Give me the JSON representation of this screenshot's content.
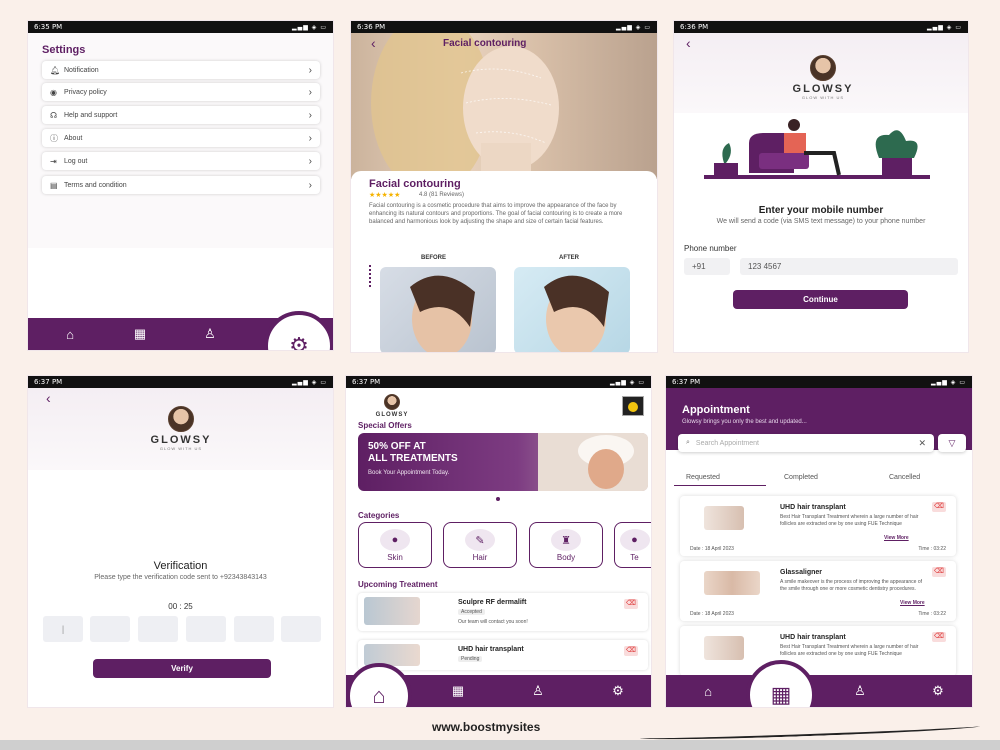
{
  "s1": {
    "status_time": "6:35 PM",
    "status_icons": "◐ ▣ ◉ ✦",
    "status_right": "▂▄▆ ◈ ▭",
    "title": "Settings",
    "items": [
      {
        "label": "Notification",
        "icon": "bell-icon"
      },
      {
        "label": "Privacy policy",
        "icon": "lock-icon"
      },
      {
        "label": "Help and support",
        "icon": "headset-icon"
      },
      {
        "label": "About",
        "icon": "info-icon"
      },
      {
        "label": "Log out",
        "icon": "logout-icon"
      },
      {
        "label": "Terms and condition",
        "icon": "document-icon"
      }
    ]
  },
  "s2": {
    "status_time": "6:36 PM",
    "header_title": "Facial contouring",
    "title": "Facial contouring",
    "stars": "★★★★★",
    "rating": "4.8 (81 Reviews)",
    "description": "Facial contouring is a cosmetic procedure that aims to improve the appearance of the face by enhancing its natural contours and proportions. The goal of facial contouring is to create a more balanced and harmonious look by adjusting the shape and size of certain facial features.",
    "before": "BEFORE",
    "after": "AFTER"
  },
  "s3": {
    "status_time": "6:36 PM",
    "brand": "GLOWSY",
    "tagline": "GLOW WITH US",
    "heading": "Enter your mobile number",
    "subtext": "We will send a code (via SMS text message) to your phone number",
    "phone_label": "Phone number",
    "country_code": "+91",
    "phone_value": "123 4567",
    "continue": "Continue"
  },
  "s4": {
    "status_time": "6:37 PM",
    "brand": "GLOWSY",
    "tagline": "GLOW WITH US",
    "heading": "Verification",
    "subtext": "Please type the verification code sent to +92343843143",
    "timer": "00 : 25",
    "code_first": "|",
    "verify": "Verify"
  },
  "s5": {
    "status_time": "6:37 PM",
    "brand": "GLOWSY",
    "special_offers": "Special Offers",
    "offer_line1": "50% OFF AT",
    "offer_line2": "ALL TREATMENTS",
    "offer_sub": "Book Your Appointment Today.",
    "categories_title": "Categories",
    "categories": [
      {
        "label": "Skin",
        "icon": "●"
      },
      {
        "label": "Hair",
        "icon": "✎"
      },
      {
        "label": "Body",
        "icon": "♜"
      },
      {
        "label": "Te",
        "icon": "●"
      }
    ],
    "upcoming_title": "Upcoming Treatment",
    "treatments": [
      {
        "name": "Sculpre RF dermalift",
        "status": "Accepted",
        "note": "Our team will contact you soon!"
      },
      {
        "name": "UHD hair transplant",
        "status": "Pending",
        "note": ""
      }
    ]
  },
  "s6": {
    "status_time": "6:37 PM",
    "title": "Appointment",
    "subtitle": "Glowsy brings you only the best and updated...",
    "search_placeholder": "Search Appointment",
    "tabs": [
      "Requested",
      "Completed",
      "Cancelled"
    ],
    "appointments": [
      {
        "name": "UHD hair transplant",
        "desc": "Best Hair Transplant Treatment wherein a large number of hair follicles are extracted one by one using FUE Technique",
        "more": "View More",
        "date": "Date : 18 April 2023",
        "time": "Time : 03:22"
      },
      {
        "name": "Glassaligner",
        "desc": "A smile makeover is the process of improving the appearance of the smile through one or more cosmetic dentistry procedures.",
        "more": "View More",
        "date": "Date : 18 April 2023",
        "time": "Time : 03:22"
      },
      {
        "name": "UHD hair transplant",
        "desc": "Best Hair Transplant Treatment wherein a large number of hair follicles are extracted one by one using FUE Technique",
        "more": "View More",
        "date": "",
        "time": ""
      }
    ]
  },
  "footer": "www.boostmysites"
}
